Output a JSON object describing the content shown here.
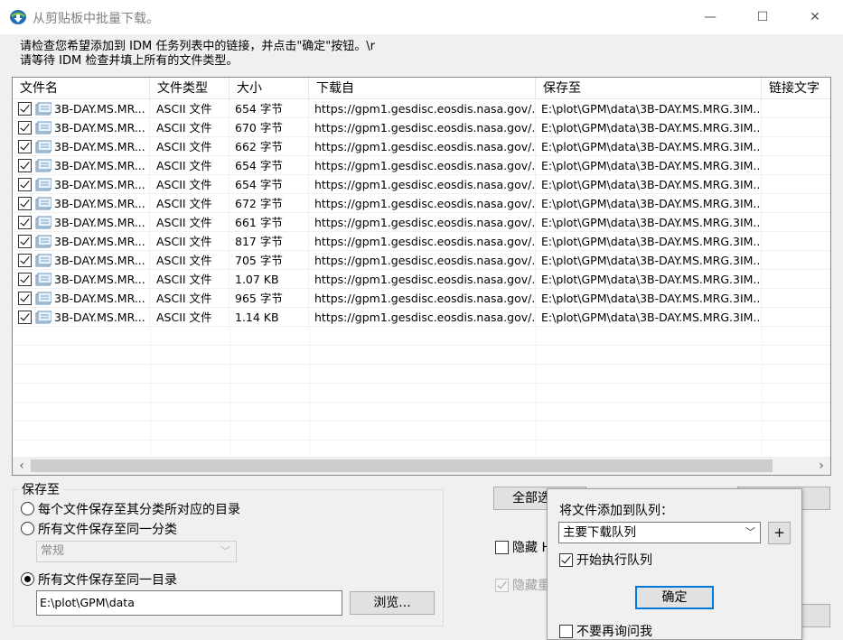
{
  "window": {
    "title": "从剪贴板中批量下载。",
    "minimize": "—",
    "maximize": "☐",
    "close": "✕"
  },
  "instructions": {
    "line1": "请检查您希望添加到 IDM 任务列表中的链接，并点击\"确定\"按钮。\\r",
    "line2": "请等待 IDM 检查并填上所有的文件类型。"
  },
  "table": {
    "columns": [
      "文件名",
      "文件类型",
      "大小",
      "下载自",
      "保存至",
      "链接文字"
    ],
    "rows": [
      {
        "name": "3B-DAY.MS.MR...",
        "type": "ASCII 文件",
        "size": "654 字节",
        "from": "https://gpm1.gesdisc.eosdis.nasa.gov/...",
        "saveto": "E:\\plot\\GPM\\data\\3B-DAY.MS.MRG.3IM..."
      },
      {
        "name": "3B-DAY.MS.MR...",
        "type": "ASCII 文件",
        "size": "670 字节",
        "from": "https://gpm1.gesdisc.eosdis.nasa.gov/...",
        "saveto": "E:\\plot\\GPM\\data\\3B-DAY.MS.MRG.3IM..."
      },
      {
        "name": "3B-DAY.MS.MR...",
        "type": "ASCII 文件",
        "size": "662 字节",
        "from": "https://gpm1.gesdisc.eosdis.nasa.gov/...",
        "saveto": "E:\\plot\\GPM\\data\\3B-DAY.MS.MRG.3IM..."
      },
      {
        "name": "3B-DAY.MS.MR...",
        "type": "ASCII 文件",
        "size": "654 字节",
        "from": "https://gpm1.gesdisc.eosdis.nasa.gov/...",
        "saveto": "E:\\plot\\GPM\\data\\3B-DAY.MS.MRG.3IM..."
      },
      {
        "name": "3B-DAY.MS.MR...",
        "type": "ASCII 文件",
        "size": "654 字节",
        "from": "https://gpm1.gesdisc.eosdis.nasa.gov/...",
        "saveto": "E:\\plot\\GPM\\data\\3B-DAY.MS.MRG.3IM..."
      },
      {
        "name": "3B-DAY.MS.MR...",
        "type": "ASCII 文件",
        "size": "672 字节",
        "from": "https://gpm1.gesdisc.eosdis.nasa.gov/...",
        "saveto": "E:\\plot\\GPM\\data\\3B-DAY.MS.MRG.3IM..."
      },
      {
        "name": "3B-DAY.MS.MR...",
        "type": "ASCII 文件",
        "size": "661 字节",
        "from": "https://gpm1.gesdisc.eosdis.nasa.gov/...",
        "saveto": "E:\\plot\\GPM\\data\\3B-DAY.MS.MRG.3IM..."
      },
      {
        "name": "3B-DAY.MS.MR...",
        "type": "ASCII 文件",
        "size": "817 字节",
        "from": "https://gpm1.gesdisc.eosdis.nasa.gov/...",
        "saveto": "E:\\plot\\GPM\\data\\3B-DAY.MS.MRG.3IM..."
      },
      {
        "name": "3B-DAY.MS.MR...",
        "type": "ASCII 文件",
        "size": "705 字节",
        "from": "https://gpm1.gesdisc.eosdis.nasa.gov/...",
        "saveto": "E:\\plot\\GPM\\data\\3B-DAY.MS.MRG.3IM..."
      },
      {
        "name": "3B-DAY.MS.MR...",
        "type": "ASCII 文件",
        "size": "1.07 KB",
        "from": "https://gpm1.gesdisc.eosdis.nasa.gov/...",
        "saveto": "E:\\plot\\GPM\\data\\3B-DAY.MS.MRG.3IM..."
      },
      {
        "name": "3B-DAY.MS.MR...",
        "type": "ASCII 文件",
        "size": "965 字节",
        "from": "https://gpm1.gesdisc.eosdis.nasa.gov/...",
        "saveto": "E:\\plot\\GPM\\data\\3B-DAY.MS.MRG.3IM..."
      },
      {
        "name": "3B-DAY.MS.MR...",
        "type": "ASCII 文件",
        "size": "1.14 KB",
        "from": "https://gpm1.gesdisc.eosdis.nasa.gov/...",
        "saveto": "E:\\plot\\GPM\\data\\3B-DAY.MS.MRG.3IM..."
      }
    ],
    "scroll_left": "‹",
    "scroll_right": "›"
  },
  "save_group": {
    "title": "保存至",
    "option1": "每个文件保存至其分类所对应的目录",
    "option2": "所有文件保存至同一分类",
    "category_value": "常规",
    "option3": "所有文件保存至同一目录",
    "directory_value": "E:\\plot\\GPM\\data",
    "browse_label": "浏览..."
  },
  "right_panel": {
    "select_all_partial": "全部选",
    "hide_label_partial": "隐藏 H",
    "hide_dup_partial": "隐藏重"
  },
  "queue_popup": {
    "label": "将文件添加到队列：",
    "queue_value": "主要下载队列",
    "add_button": "+",
    "start_queue_label": "开始执行队列",
    "ok_label": "确定",
    "dont_ask_label": "不要再询问我"
  },
  "colors": {
    "accent": "#0078d7",
    "window_bg": "#f0f0f0"
  }
}
